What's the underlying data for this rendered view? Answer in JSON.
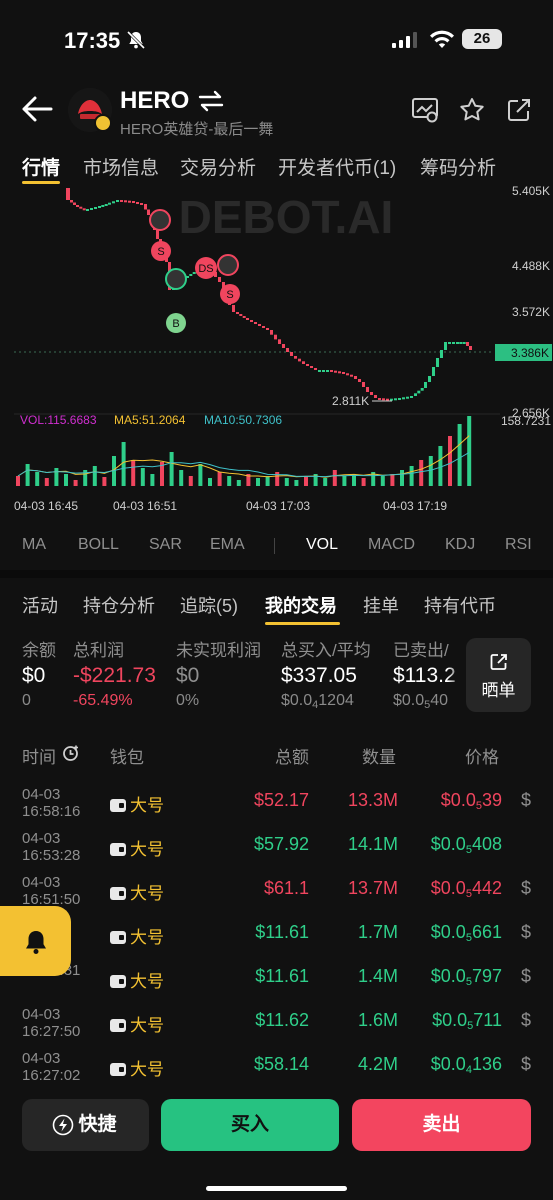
{
  "status_bar": {
    "time": "17:35",
    "battery": "26"
  },
  "header": {
    "title": "HERO",
    "subtitle": "HERO英雄贷-最后一舞"
  },
  "main_tabs": [
    {
      "label": "行情",
      "active": true
    },
    {
      "label": "市场信息"
    },
    {
      "label": "交易分析"
    },
    {
      "label": "开发者代币(1)"
    },
    {
      "label": "筹码分析"
    }
  ],
  "chart": {
    "watermark": "DEBOT.AI",
    "price_labels": [
      "5.405K",
      "4.488K",
      "3.572K",
      "2.656K"
    ],
    "current_price": "3.386K",
    "low_marker": "2.811K",
    "vol_label": "VOL:115.6683",
    "ma5_label": "MA5:51.2064",
    "ma10_label": "MA10:50.7306",
    "vol_max": "158.7231",
    "time_labels": [
      "04-03 16:45",
      "04-03 16:51",
      "04-03 17:03",
      "04-03 17:19"
    ],
    "markers": [
      "S",
      "DS",
      "S",
      "B"
    ],
    "colors": {
      "up": "#2fcf8a",
      "down": "#f0455e",
      "ma5": "#f3c132",
      "ma10": "#3fc1c9",
      "vol": "#d02fd0"
    }
  },
  "indicator_tabs": [
    {
      "label": "MA"
    },
    {
      "label": "BOLL"
    },
    {
      "label": "SAR"
    },
    {
      "label": "EMA"
    },
    {
      "label": "VOL",
      "active": true
    },
    {
      "label": "MACD"
    },
    {
      "label": "KDJ"
    },
    {
      "label": "RSI"
    }
  ],
  "sub_tabs": [
    {
      "label": "活动"
    },
    {
      "label": "持仓分析"
    },
    {
      "label": "追踪(5)"
    },
    {
      "label": "我的交易",
      "active": true
    },
    {
      "label": "挂单"
    },
    {
      "label": "持有代币"
    }
  ],
  "stats": {
    "balance": {
      "label": "余额",
      "value": "$0",
      "sub": "0"
    },
    "total_profit": {
      "label": "总利润",
      "value": "-$221.73",
      "sub": "-65.49%"
    },
    "unrealized": {
      "label": "未实现利润",
      "value": "$0",
      "sub": "0%"
    },
    "total_buy": {
      "label": "总买入/平均",
      "value": "$337.05",
      "sub_a": "$0.0",
      "sub_sub": "4",
      "sub_b": "1204"
    },
    "sold": {
      "label": "已卖出/",
      "value": "$113.2",
      "sub_a": "$0.0",
      "sub_sub": "5",
      "sub_b": "40"
    },
    "share_label": "晒单"
  },
  "table": {
    "headers": {
      "time": "时间",
      "wallet": "钱包",
      "total": "总额",
      "qty": "数量",
      "price": "价格"
    },
    "rows": [
      {
        "date": "04-03",
        "time": "16:58:16",
        "wallet": "大号",
        "total": "$52.17",
        "qty": "13.3M",
        "price_a": "$0.0",
        "price_sub": "5",
        "price_b": "39",
        "side": "sell",
        "dollar": "$"
      },
      {
        "date": "04-03",
        "time": "16:53:28",
        "wallet": "大号",
        "total": "$57.92",
        "qty": "14.1M",
        "price_a": "$0.0",
        "price_sub": "5",
        "price_b": "408",
        "side": "buy",
        "dollar": ""
      },
      {
        "date": "04-03",
        "time": "16:51:50",
        "wallet": "大号",
        "total": "$61.1",
        "qty": "13.7M",
        "price_a": "$0.0",
        "price_sub": "5",
        "price_b": "442",
        "side": "sell",
        "dollar": "$"
      },
      {
        "date": "",
        "time": "16",
        "wallet": "大号",
        "total": "$11.61",
        "qty": "1.7M",
        "price_a": "$0.0",
        "price_sub": "5",
        "price_b": "661",
        "side": "buy",
        "dollar": "$"
      },
      {
        "date": "",
        "time": "16:31:31",
        "wallet": "大号",
        "total": "$11.61",
        "qty": "1.4M",
        "price_a": "$0.0",
        "price_sub": "5",
        "price_b": "797",
        "side": "buy",
        "dollar": "$"
      },
      {
        "date": "04-03",
        "time": "16:27:50",
        "wallet": "大号",
        "total": "$11.62",
        "qty": "1.6M",
        "price_a": "$0.0",
        "price_sub": "5",
        "price_b": "711",
        "side": "buy",
        "dollar": "$"
      },
      {
        "date": "04-03",
        "time": "16:27:02",
        "wallet": "大号",
        "total": "$58.14",
        "qty": "4.2M",
        "price_a": "$0.0",
        "price_sub": "4",
        "price_b": "136",
        "side": "buy",
        "dollar": "$"
      }
    ]
  },
  "buttons": {
    "quick": "快捷",
    "buy": "买入",
    "sell": "卖出"
  }
}
